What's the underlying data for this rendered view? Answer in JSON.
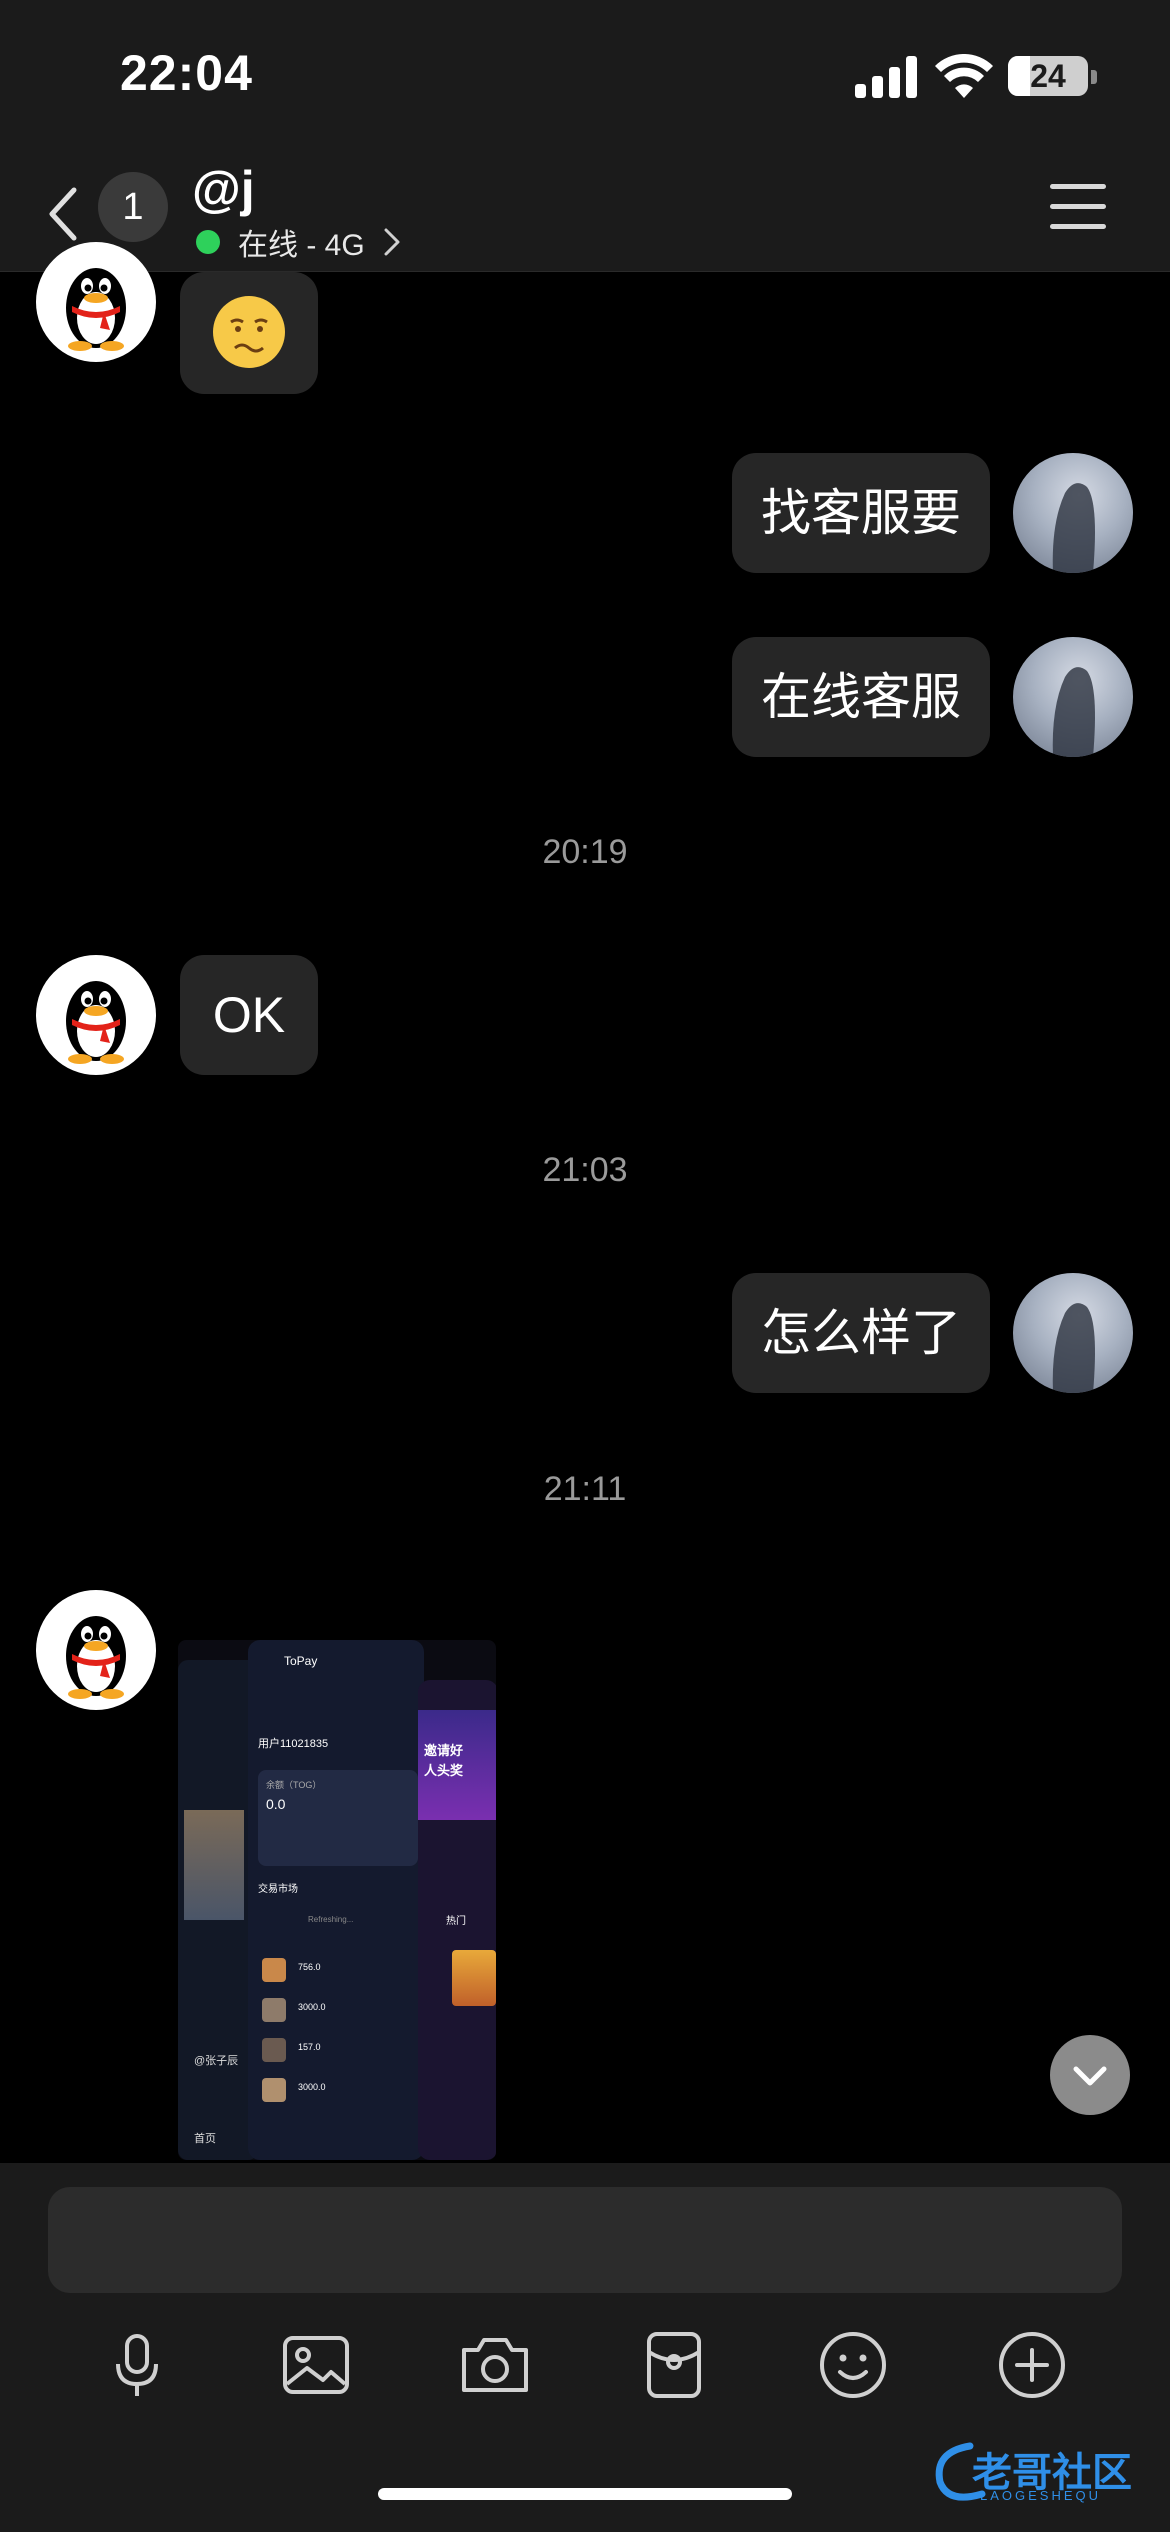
{
  "status_bar": {
    "time": "22:04",
    "battery": "24"
  },
  "header": {
    "unread_count": "1",
    "title": "@j",
    "status_text": "在线 - 4G"
  },
  "messages": [
    {
      "side": "left",
      "type": "emoji"
    },
    {
      "side": "right",
      "type": "text",
      "text": "找客服要"
    },
    {
      "side": "right",
      "type": "text",
      "text": "在线客服"
    },
    {
      "type": "time",
      "text": "20:19"
    },
    {
      "side": "left",
      "type": "text",
      "text": "OK"
    },
    {
      "type": "time",
      "text": "21:03"
    },
    {
      "side": "right",
      "type": "text",
      "text": "怎么样了"
    },
    {
      "type": "time",
      "text": "21:11"
    },
    {
      "side": "left",
      "type": "image"
    }
  ],
  "shared_image": {
    "app_name": "ToPay",
    "user_id": "用户11021835",
    "balance_label": "余额（TOG）",
    "balance": "0.0",
    "market_label": "交易市场",
    "refreshing": "Refreshing...",
    "list_values": [
      "756.0",
      "3000.0",
      "157.0",
      "3000.0"
    ],
    "promo_line1": "邀请好",
    "promo_line2": "人头奖",
    "hot_label": "热门",
    "side_label": "@张子辰",
    "home_label": "首页"
  },
  "toolbar": {
    "icons": [
      "microphone-icon",
      "image-icon",
      "camera-icon",
      "red-packet-icon",
      "emoji-icon",
      "plus-icon"
    ]
  },
  "watermark": {
    "text": "老哥社区",
    "sub": "LAOGESHEQU"
  },
  "colors": {
    "background": "#000000",
    "bar": "#1b1b1b",
    "bubble": "#262626",
    "online": "#2ed15b"
  }
}
